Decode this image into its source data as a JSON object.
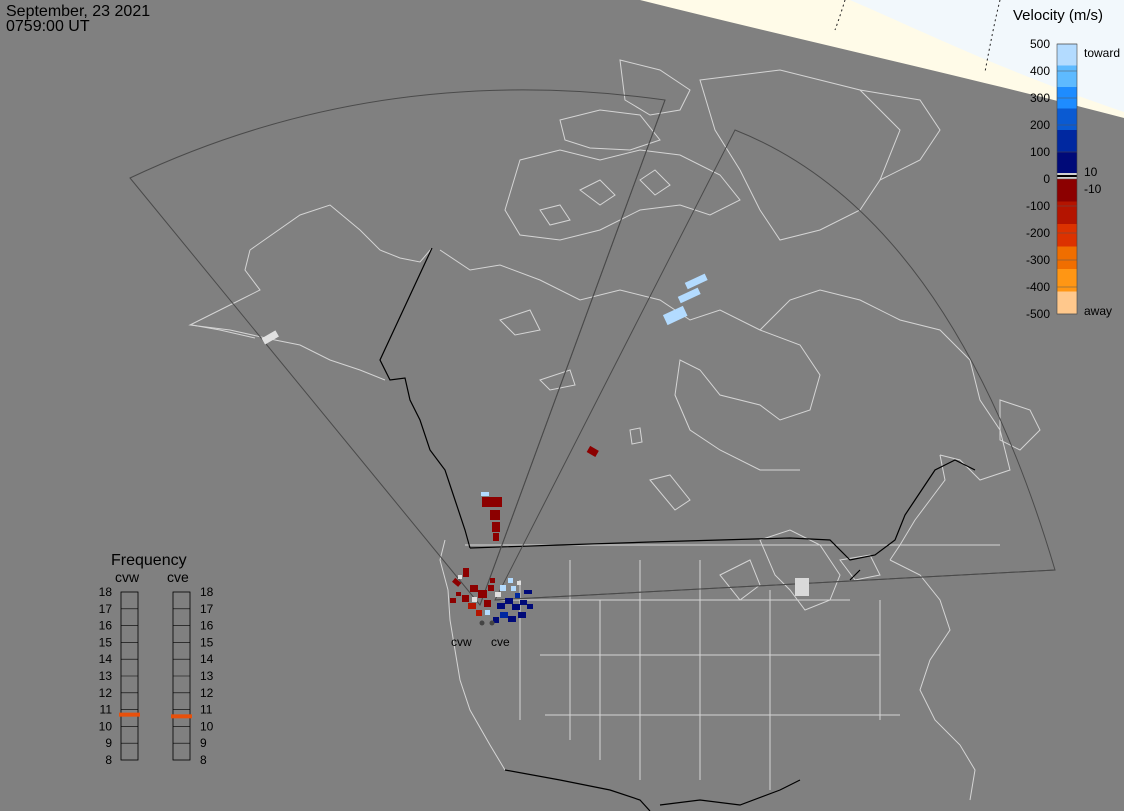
{
  "header": {
    "date": "September, 23 2021",
    "time": "0759:00 UT"
  },
  "legend": {
    "title": "Velocity (m/s)",
    "ticks": [
      "500",
      "400",
      "300",
      "200",
      "100",
      "0",
      "-100",
      "-200",
      "-300",
      "-400",
      "-500"
    ],
    "toward_label": "toward",
    "away_label": "away",
    "threshold_pos": "10",
    "threshold_neg": "-10",
    "colors": [
      "#b3dbff",
      "#5ebaff",
      "#1e8cff",
      "#0a5ad2",
      "#0028a0",
      "#000a78",
      "#8c0000",
      "#b41400",
      "#dc3200",
      "#f06e00",
      "#ff9614",
      "#ffc88c"
    ]
  },
  "radars": {
    "west_label": "cvw",
    "east_label": "cve"
  },
  "frequency": {
    "title": "Frequency",
    "cvw_label": "cvw",
    "cve_label": "cve",
    "scale": [
      "18",
      "17",
      "16",
      "15",
      "14",
      "13",
      "12",
      "11",
      "10",
      "9",
      "8"
    ],
    "cvw_value_mhz": 10.7,
    "cve_value_mhz": 10.6,
    "marker_color": "#e8500a"
  },
  "colors": {
    "background": "#808080",
    "coastline": "#d9d9d9",
    "boundary": "#000000",
    "field_of_view": "#4a4a4a",
    "daylight": "#fffbe6",
    "ice": "#eef6fb"
  }
}
